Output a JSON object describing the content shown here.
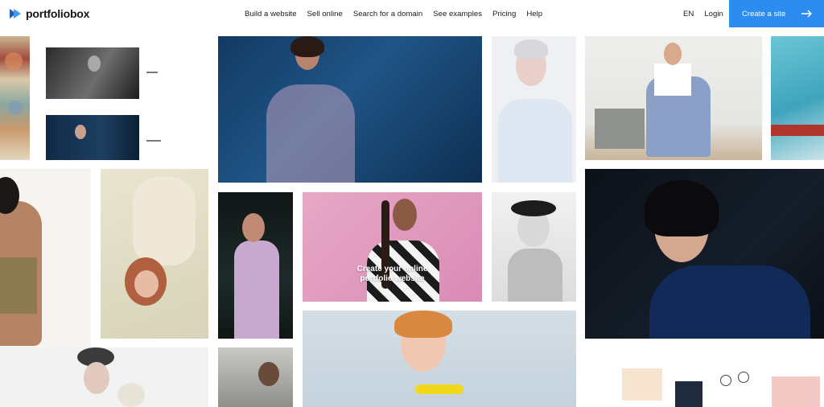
{
  "header": {
    "brand": "portfoliobox",
    "nav": [
      {
        "label": "Build a website"
      },
      {
        "label": "Sell online"
      },
      {
        "label": "Search for a domain"
      },
      {
        "label": "See examples"
      },
      {
        "label": "Pricing"
      },
      {
        "label": "Help"
      }
    ],
    "language": "EN",
    "login": "Login",
    "cta": "Create a site"
  },
  "hero": {
    "line1": "Create your online",
    "line2": "portfolio website"
  },
  "colors": {
    "accent": "#2d8cf0",
    "logo_dark": "#1f5fb0",
    "logo_light": "#3d9bf5"
  },
  "icons": {
    "logo": "portfoliobox-logo-icon",
    "cta_arrow": "arrow-right-icon"
  }
}
